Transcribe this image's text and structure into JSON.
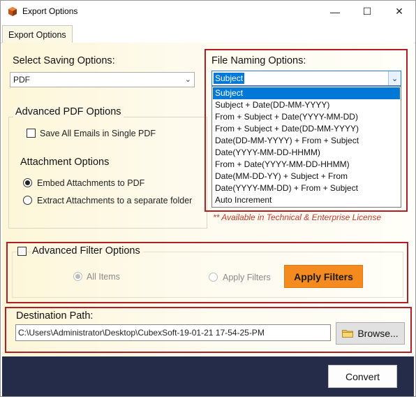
{
  "window": {
    "title": "Export Options",
    "minimize_glyph": "—",
    "maximize_glyph": "☐",
    "close_glyph": "✕"
  },
  "tabs": [
    {
      "label": "Export Options",
      "active": true
    }
  ],
  "saving": {
    "title": "Select Saving Options:",
    "selected": "PDF"
  },
  "naming": {
    "title": "File Naming Options:",
    "selected": "Subject",
    "options": [
      "Subject",
      "Subject + Date(DD-MM-YYYY)",
      "From + Subject + Date(YYYY-MM-DD)",
      "From + Subject + Date(DD-MM-YYYY)",
      "Date(DD-MM-YYYY) + From + Subject",
      "Date(YYYY-MM-DD-HHMM)",
      "From + Date(YYYY-MM-DD-HHMM)",
      "Date(MM-DD-YY) + Subject + From",
      "Date(YYYY-MM-DD) + From + Subject",
      "Auto Increment"
    ],
    "license_note": "**  Available in Technical & Enterprise License"
  },
  "pdf_options": {
    "title": "Advanced PDF Options",
    "save_all_label": "Save All Emails in Single PDF",
    "save_all_checked": false
  },
  "attachment": {
    "title": "Attachment Options",
    "embed_label": "Embed Attachments to PDF",
    "extract_label": "Extract Attachments to a separate folder",
    "selected": "embed"
  },
  "filter": {
    "title": "Advanced Filter Options",
    "enabled": false,
    "all_items_label": "All Items",
    "apply_filters_radio_label": "Apply Filters",
    "apply_button_label": "Apply Filters"
  },
  "destination": {
    "title": "Destination Path:",
    "path": "C:\\Users\\Administrator\\Desktop\\CubexSoft-19-01-21 17-54-25-PM",
    "browse_label": "Browse..."
  },
  "footer": {
    "convert_label": "Convert"
  },
  "colors": {
    "highlight_border": "#b11f24",
    "accent_orange": "#f58a1f",
    "selection_blue": "#0078d7",
    "footer_navy": "#252c4a",
    "note_red": "#c0392b"
  }
}
